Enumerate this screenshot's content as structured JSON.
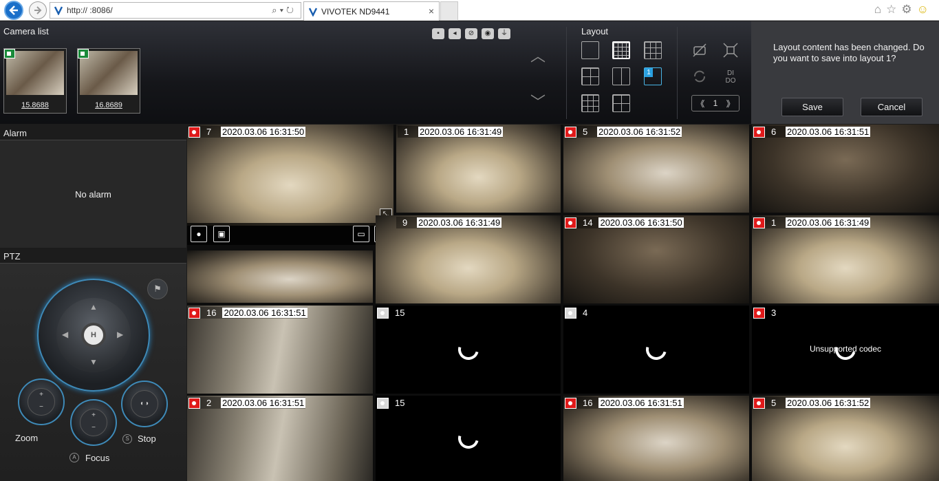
{
  "browser": {
    "url": "http://                :8086/",
    "tab_title": "VIVOTEK ND9441",
    "tab_close": "×"
  },
  "camera_list": {
    "title": "Camera list",
    "cameras": [
      {
        "label": "15.8688"
      },
      {
        "label": "16.8689"
      }
    ]
  },
  "layout": {
    "title": "Layout",
    "custom_layout_number": "1",
    "page": "1"
  },
  "save_dialog": {
    "message": "Layout content has been changed. Do you want to save into layout 1?",
    "save_label": "Save",
    "cancel_label": "Cancel"
  },
  "alarm": {
    "title": "Alarm",
    "empty_text": "No alarm"
  },
  "ptz": {
    "title": "PTZ",
    "home_label": "H",
    "zoom_label": "Zoom",
    "focus_label": "Focus",
    "stop_label": "Stop",
    "focus_letter": "A",
    "stop_letter": "S"
  },
  "tiles": [
    {
      "num": "7",
      "time": "2020.03.06 16:31:50",
      "recording": true,
      "state": "video"
    },
    {
      "num": "1",
      "time": "2020.03.06 16:31:49",
      "recording": false,
      "state": "video"
    },
    {
      "num": "5",
      "time": "2020.03.06 16:31:52",
      "recording": true,
      "state": "video"
    },
    {
      "num": "6",
      "time": "2020.03.06 16:31:51",
      "recording": true,
      "state": "video"
    },
    {
      "num": "9",
      "time": "2020.03.06 16:31:49",
      "recording": false,
      "state": "video"
    },
    {
      "num": "14",
      "time": "2020.03.06 16:31:50",
      "recording": true,
      "state": "video"
    },
    {
      "num": "1",
      "time": "2020.03.06 16:31:49",
      "recording": true,
      "state": "video"
    },
    {
      "num": "16",
      "time": "2020.03.06 16:31:51",
      "recording": true,
      "state": "video"
    },
    {
      "num": "15",
      "time": "",
      "recording": false,
      "state": "loading"
    },
    {
      "num": "4",
      "time": "",
      "recording": false,
      "state": "loading"
    },
    {
      "num": "3",
      "time": "",
      "recording": true,
      "state": "loading",
      "message": "Unsupported codec"
    },
    {
      "num": "2",
      "time": "2020.03.06 16:31:51",
      "recording": true,
      "state": "video"
    },
    {
      "num": "15",
      "time": "",
      "recording": false,
      "state": "loading"
    },
    {
      "num": "16",
      "time": "2020.03.06 16:31:51",
      "recording": true,
      "state": "video"
    },
    {
      "num": "5",
      "time": "2020.03.06 16:31:52",
      "recording": true,
      "state": "video"
    }
  ],
  "colors": {
    "record_red": "#e01a1a",
    "accent_blue": "#2aa0e0",
    "live_green": "#1a8a3a"
  },
  "icons": {
    "back": "back-arrow-icon",
    "forward": "forward-arrow-icon",
    "home": "home-icon",
    "favorites": "star-icon",
    "settings": "gear-icon",
    "feedback": "smiley-icon"
  }
}
